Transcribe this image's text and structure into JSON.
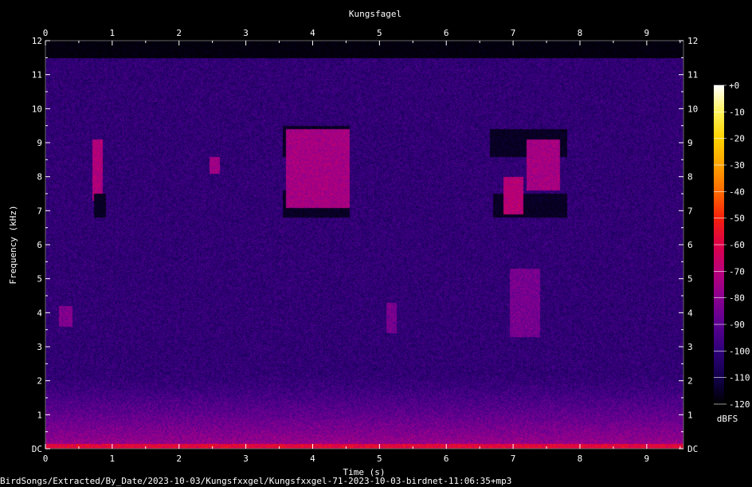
{
  "chart_data": {
    "type": "heatmap",
    "title": "Kungsfagel",
    "xlabel": "Time (s)",
    "ylabel": "Frequency (kHz)",
    "xlim": [
      0,
      9.55
    ],
    "ylim": [
      0,
      12
    ],
    "x_ticks": [
      "0",
      "1",
      "2",
      "3",
      "4",
      "5",
      "6",
      "7",
      "8",
      "9"
    ],
    "y_ticks": [
      "DC",
      "1",
      "2",
      "3",
      "4",
      "5",
      "6",
      "7",
      "8",
      "9",
      "10",
      "11",
      "12"
    ],
    "colorbar": {
      "label": "dBFS",
      "range": [
        -120,
        0
      ],
      "ticks": [
        "+0",
        "-10",
        "-20",
        "-30",
        "-40",
        "-50",
        "-60",
        "-70",
        "-80",
        "-90",
        "-100",
        "-110",
        "-120"
      ],
      "colors": [
        "#000000",
        "#12004a",
        "#2e0079",
        "#5a0090",
        "#8a008f",
        "#b8007a",
        "#dc0048",
        "#f5200c",
        "#ff6a00",
        "#ffa200",
        "#ffd200",
        "#fff35a",
        "#ffffff"
      ]
    },
    "signal_cutoff_khz": 11.5,
    "background_db": -100,
    "low_frequency_db": -75,
    "events": [
      {
        "t0": 0.7,
        "t1": 0.85,
        "f0": 7.3,
        "f1": 9.1,
        "db": -72
      },
      {
        "t0": 0.72,
        "t1": 0.9,
        "f0": 6.8,
        "f1": 7.5,
        "db": -118
      },
      {
        "t0": 2.45,
        "t1": 2.6,
        "f0": 8.1,
        "f1": 8.6,
        "db": -76
      },
      {
        "t0": 3.55,
        "t1": 4.55,
        "f0": 6.8,
        "f1": 7.6,
        "db": -118
      },
      {
        "t0": 3.55,
        "t1": 4.55,
        "f0": 8.6,
        "f1": 9.5,
        "db": -118
      },
      {
        "t0": 3.6,
        "t1": 4.55,
        "f0": 7.1,
        "f1": 9.4,
        "db": -74
      },
      {
        "t0": 6.7,
        "t1": 7.8,
        "f0": 6.8,
        "f1": 7.5,
        "db": -118
      },
      {
        "t0": 6.65,
        "t1": 7.8,
        "f0": 8.6,
        "f1": 9.4,
        "db": -118
      },
      {
        "t0": 6.85,
        "t1": 7.15,
        "f0": 6.9,
        "f1": 8.0,
        "db": -70
      },
      {
        "t0": 7.2,
        "t1": 7.7,
        "f0": 7.6,
        "f1": 9.1,
        "db": -74
      },
      {
        "t0": 6.95,
        "t1": 7.4,
        "f0": 3.3,
        "f1": 5.3,
        "db": -84
      },
      {
        "t0": 5.1,
        "t1": 5.25,
        "f0": 3.4,
        "f1": 4.3,
        "db": -84
      },
      {
        "t0": 0.2,
        "t1": 0.4,
        "f0": 3.6,
        "f1": 4.2,
        "db": -82
      }
    ]
  },
  "footer": {
    "path": "BirdSongs/Extracted/By_Date/2023-10-03/Kungsfxxgel/Kungsfxxgel-71-2023-10-03-birdnet-11:06:35+mp3"
  }
}
